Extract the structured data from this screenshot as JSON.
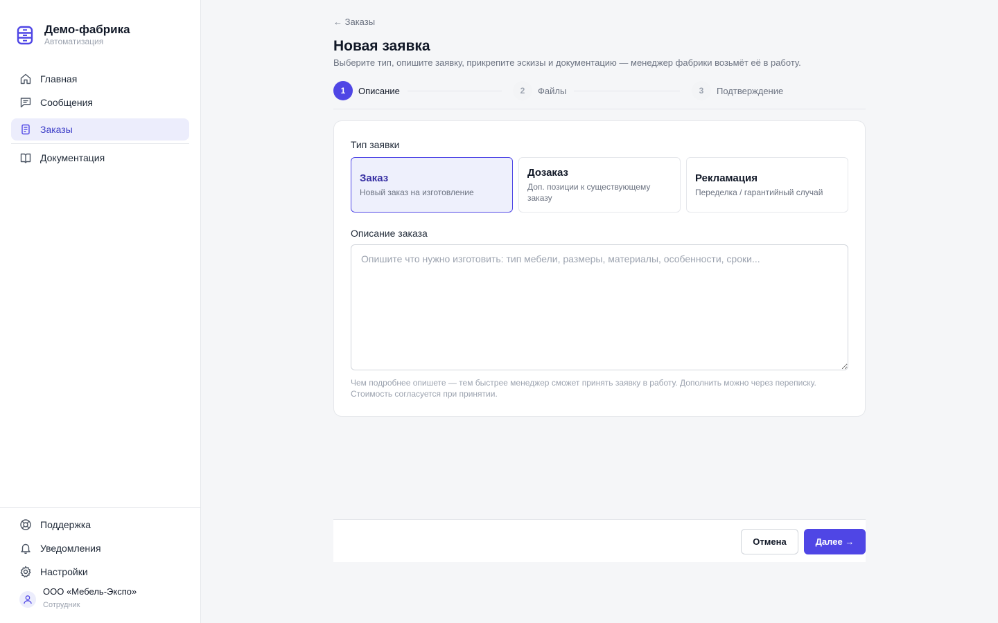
{
  "brand": {
    "title": "Демо-фабрика",
    "subtitle": "Автоматизация"
  },
  "nav": {
    "items": [
      {
        "label": "Главная",
        "icon": "home-icon"
      },
      {
        "label": "Сообщения",
        "icon": "message-icon"
      },
      {
        "label": "Заказы",
        "icon": "document-icon",
        "active": true
      },
      {
        "label": "Документация",
        "icon": "book-icon"
      }
    ]
  },
  "bottom_nav": {
    "items": [
      {
        "label": "Поддержка",
        "icon": "lifebuoy-icon"
      },
      {
        "label": "Уведомления",
        "icon": "bell-icon"
      },
      {
        "label": "Настройки",
        "icon": "gear-icon"
      }
    ]
  },
  "user": {
    "name": "ООО «Мебель-Экспо»",
    "role": "Сотрудник"
  },
  "page": {
    "back_link": "← Заказы",
    "title": "Новая заявка",
    "subtitle": "Выберите тип, опишите заявку, прикрепите эскизы и документацию — менеджер фабрики возьмёт её в работу."
  },
  "steps": [
    {
      "num": "1",
      "label": "Описание",
      "state": "current"
    },
    {
      "num": "2",
      "label": "Файлы",
      "state": "todo"
    },
    {
      "num": "3",
      "label": "Подтверждение",
      "state": "todo"
    }
  ],
  "form": {
    "type_label": "Тип заявки",
    "types": [
      {
        "title": "Заказ",
        "desc": "Новый заказ на изготовление",
        "selected": true
      },
      {
        "title": "Дозаказ",
        "desc": "Доп. позиции к существующему заказу",
        "selected": false
      },
      {
        "title": "Рекламация",
        "desc": "Переделка / гарантийный случай",
        "selected": false
      }
    ],
    "description_label": "Описание заказа",
    "description_value": "",
    "description_placeholder": "Опишите что нужно изготовить: тип мебели, размеры, материалы, особенности, сроки...",
    "hint": "Чем подробнее опишете — тем быстрее менеджер сможет принять заявку в работу. Дополнить можно через переписку. Стоимость согласуется при принятии."
  },
  "footer": {
    "cancel_label": "Отмена",
    "next_label": "Далее →"
  },
  "colors": {
    "accent": "#4f46e5",
    "accent_bg": "#ecedfc",
    "border": "#e5e7eb"
  }
}
